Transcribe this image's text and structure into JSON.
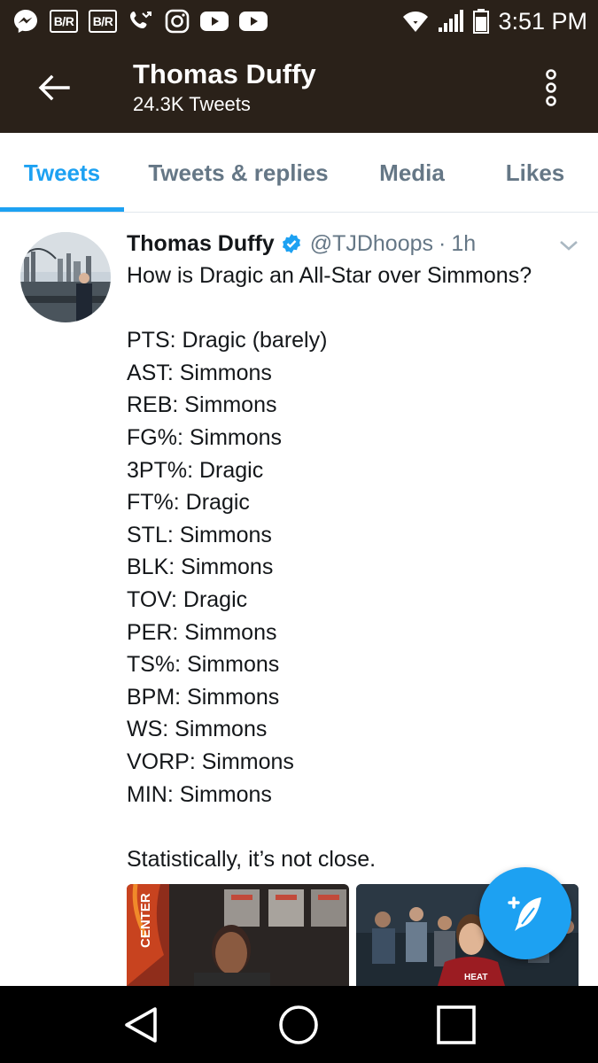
{
  "status_bar": {
    "time": "3:51 PM",
    "badge_1": "B/R",
    "badge_2": "B/R",
    "icons_left": [
      "messenger-icon",
      "bleacher-report-icon",
      "bleacher-report-icon",
      "missed-call-icon",
      "instagram-icon",
      "youtube-icon",
      "youtube-icon"
    ],
    "icons_right": [
      "wifi-icon",
      "signal-icon",
      "battery-icon"
    ]
  },
  "header": {
    "title": "Thomas Duffy",
    "subtitle": "24.3K Tweets"
  },
  "tabs": [
    {
      "label": "Tweets",
      "active": true
    },
    {
      "label": "Tweets & replies",
      "active": false
    },
    {
      "label": "Media",
      "active": false
    },
    {
      "label": "Likes",
      "active": false
    }
  ],
  "tweet": {
    "name": "Thomas Duffy",
    "handle": "@TJDhoops",
    "separator": "·",
    "time": "1h",
    "lines": [
      "How is Dragic an All-Star over Simmons?",
      "",
      "PTS: Dragic (barely)",
      "AST: Simmons",
      "REB: Simmons",
      "FG%: Simmons",
      "3PT%: Dragic",
      "FT%: Dragic",
      "STL: Simmons",
      "BLK: Simmons",
      "TOV: Dragic",
      "PER: Simmons",
      "TS%: Simmons",
      "BPM: Simmons",
      "WS: Simmons",
      "VORP: Simmons",
      "MIN: Simmons",
      "",
      "Statistically, it’s not close."
    ],
    "media_badge": "CENTER"
  },
  "colors": {
    "brand_blue": "#1da1f2",
    "header_bg": "#2a2119",
    "muted_text": "#657786",
    "body_text": "#14171a"
  }
}
